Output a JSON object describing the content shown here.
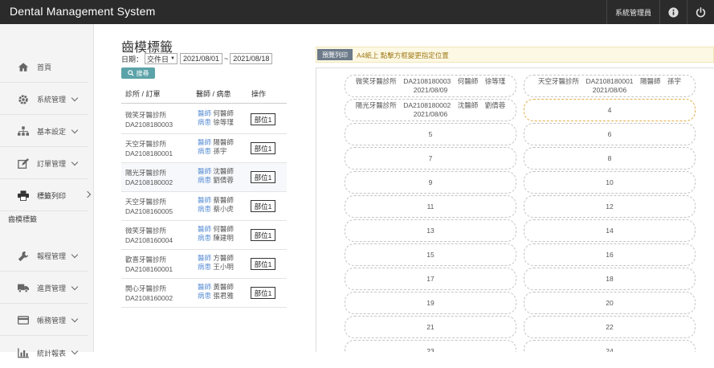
{
  "app": {
    "title": "Dental Management System",
    "user": "系統管理員"
  },
  "icons": {
    "info": "info-icon",
    "power": "power-icon"
  },
  "sidebar": {
    "items": [
      {
        "label": "首頁",
        "icon": "home-icon"
      },
      {
        "label": "系統管理",
        "icon": "gear-icon"
      },
      {
        "label": "基本設定",
        "icon": "sitemap-icon"
      },
      {
        "label": "訂單管理",
        "icon": "edit-icon"
      },
      {
        "label": "標籤列印",
        "icon": "print-icon"
      },
      {
        "label": "報程管理",
        "icon": "wrench-icon"
      },
      {
        "label": "進貨管理",
        "icon": "truck-icon"
      },
      {
        "label": "帳務管理",
        "icon": "card-icon"
      },
      {
        "label": "統計報表",
        "icon": "chart-icon"
      }
    ],
    "subitem": "齒模標籤"
  },
  "panel": {
    "title": "齒模標籤",
    "date_label": "日期：",
    "date_type": "交件日",
    "date_from": "2021/08/01",
    "sep": "~",
    "date_to": "2021/08/18",
    "search_label": "搜尋"
  },
  "table": {
    "headers": [
      "診所 / 訂單",
      "醫師 / 病患",
      "操作"
    ],
    "doc_tag": "醫師",
    "pat_tag": "病患",
    "rows": [
      {
        "clinic": "微笑牙醫診所",
        "order": "DA2108180003",
        "doctor": "何醫師",
        "patient": "徐等瑾",
        "action": "部位1"
      },
      {
        "clinic": "天空牙醫診所",
        "order": "DA2108180001",
        "doctor": "陽醫師",
        "patient": "孫宇",
        "action": "部位1"
      },
      {
        "clinic": "陽光牙醫診所",
        "order": "DA2108180002",
        "doctor": "沈醫師",
        "patient": "劉倩蓉",
        "action": "部位1"
      },
      {
        "clinic": "天空牙醫診所",
        "order": "DA2108160005",
        "doctor": "蔡醫師",
        "patient": "蔡小虎",
        "action": "部位1"
      },
      {
        "clinic": "微笑牙醫診所",
        "order": "DA2108160004",
        "doctor": "何醫師",
        "patient": "陳建明",
        "action": "部位1"
      },
      {
        "clinic": "歡喜牙醫診所",
        "order": "DA2108160001",
        "doctor": "方醫師",
        "patient": "王小明",
        "action": "部位1"
      },
      {
        "clinic": "開心牙醫診所",
        "order": "DA2108160002",
        "doctor": "黃醫師",
        "patient": "張君雅",
        "action": "部位1"
      }
    ]
  },
  "preview": {
    "button": "預覽列印",
    "hint": "A4紙上 點擊方框變更指定位置",
    "filled": [
      {
        "line1": "微笑牙醫診所　DA2108180003　何醫師　徐等瑾",
        "line2": "2021/08/09"
      },
      {
        "line1": "天空牙醫診所　DA2108180001　陽醫師　孫宇",
        "line2": "2021/08/06"
      },
      {
        "line1": "陽光牙醫診所　DA2108180002　沈醫師　劉倩蓉",
        "line2": "2021/08/06"
      }
    ],
    "slots": [
      "4",
      "5",
      "6",
      "7",
      "8",
      "9",
      "10",
      "11",
      "12",
      "13",
      "14",
      "15",
      "16",
      "17",
      "18",
      "19",
      "20",
      "21",
      "22",
      "23",
      "24"
    ]
  }
}
